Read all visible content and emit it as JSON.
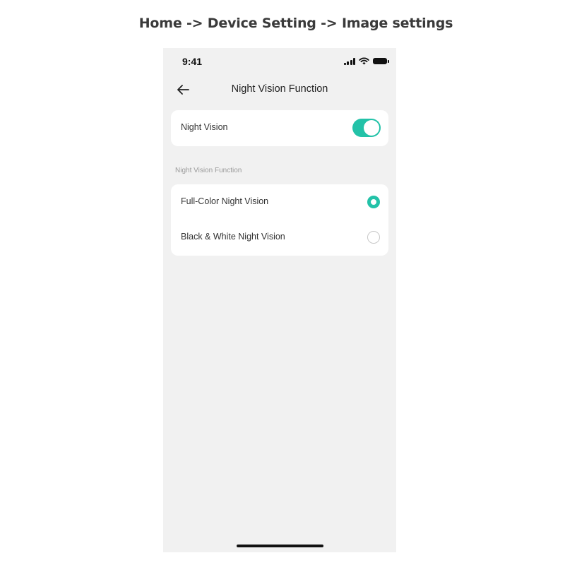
{
  "breadcrumb": "Home -> Device Setting -> Image settings",
  "status_bar": {
    "time": "9:41",
    "icons": [
      "cellular-signal-icon",
      "wifi-icon",
      "battery-icon"
    ]
  },
  "nav": {
    "back_icon": "arrow-left-icon",
    "title": "Night Vision Function"
  },
  "night_vision": {
    "label": "Night Vision",
    "enabled": true
  },
  "section": {
    "label": "Night Vision Function"
  },
  "options": [
    {
      "label": "Full-Color Night Vision",
      "selected": true
    },
    {
      "label": "Black & White Night Vision",
      "selected": false
    }
  ],
  "colors": {
    "accent": "#23c2a8",
    "background": "#f1f1f1",
    "card": "#ffffff"
  }
}
